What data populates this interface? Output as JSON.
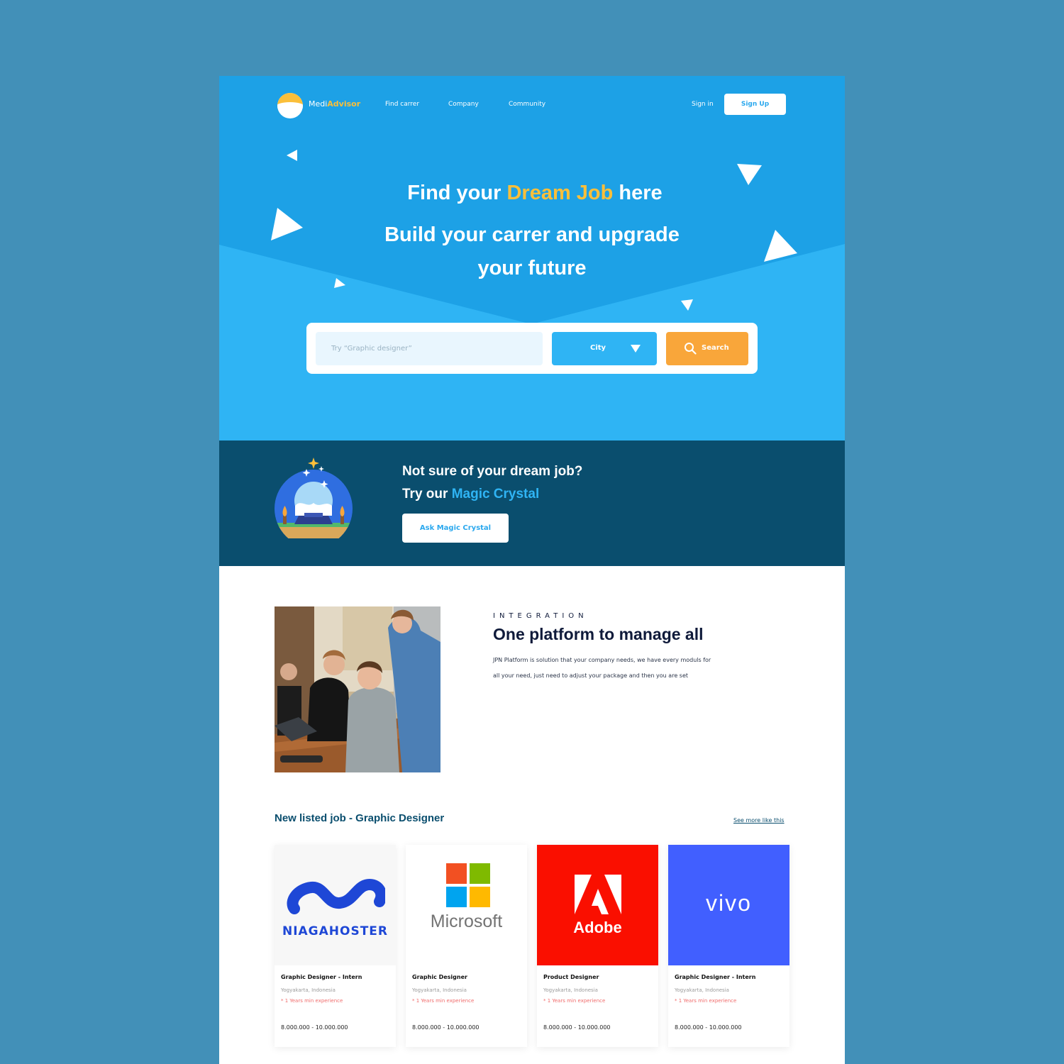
{
  "brand": {
    "name_part1": "Medi",
    "name_part2": "Advisor"
  },
  "nav": {
    "links": [
      "Find carrer",
      "Company",
      "Community"
    ],
    "sign_in": "Sign in",
    "sign_up": "Sign Up"
  },
  "hero": {
    "line1_pre": "Find your ",
    "line1_highlight": "Dream Job",
    "line1_post": " here",
    "line2": "Build your carrer and upgrade",
    "line3": "your future"
  },
  "search": {
    "placeholder": "Try “Graphic designer”",
    "city_label": "City",
    "button_label": "Search"
  },
  "magic": {
    "line1": "Not sure of your dream job?",
    "line2_pre": "Try our ",
    "line2_highlight": "Magic Crystal",
    "button_label": "Ask Magic Crystal"
  },
  "integration": {
    "eyebrow": "INTEGRATION",
    "title": "One platform to manage all",
    "desc_line1": "JPN Platform is solution that your company needs, we have every moduls for",
    "desc_line2": "all your need, just need to adjust your package and then you are set"
  },
  "jobs": {
    "title": "New listed job - Graphic Designer",
    "see_more": "See more like this",
    "cards": [
      {
        "company": "NIAGAHOSTER",
        "title": "Graphic Designer - Intern",
        "location": "Yogyakarta, Indonesia",
        "experience": "* 1 Years min experience",
        "salary": "8.000.000 - 10.000.000"
      },
      {
        "company": "Microsoft",
        "title": "Graphic Designer",
        "location": "Yogyakarta, Indonesia",
        "experience": "* 1 Years min experience",
        "salary": "8.000.000 - 10.000.000"
      },
      {
        "company": "Adobe",
        "title": "Product Designer",
        "location": "Yogyakarta, Indonesia",
        "experience": "* 1 Years min experience",
        "salary": "8.000.000 - 10.000.000"
      },
      {
        "company": "vivo",
        "title": "Graphic Designer - Intern",
        "location": "Yogyakarta, Indonesia",
        "experience": "* 1 Years min experience",
        "salary": "8.000.000 - 10.000.000"
      }
    ]
  },
  "colors": {
    "background": "#4290b8",
    "hero_blue": "#2fb4f4",
    "hero_shade": "#1da1e6",
    "accent_orange": "#f9a63a",
    "accent_yellow": "#fbbf3a",
    "navy": "#0a4e6e"
  }
}
